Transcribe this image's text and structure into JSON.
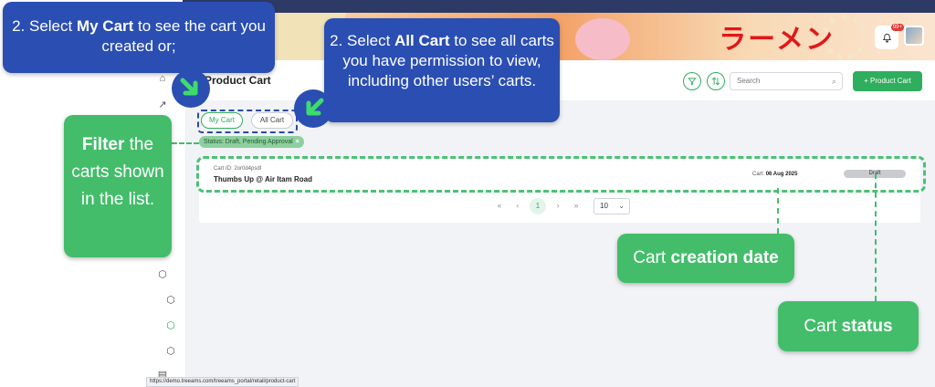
{
  "header": {
    "page_title": "Product Cart",
    "search_placeholder": "Search",
    "add_button_label": "+ Product Cart",
    "notification_badge": "99+",
    "banner_text": "ラーメン"
  },
  "tabs": {
    "my_cart": "My Cart",
    "all_cart": "All Cart"
  },
  "filter_chip": {
    "label": "Status: Draft, Pending Approval",
    "remove": "×"
  },
  "cart_row": {
    "id_label": "Cart ID: 2or0d4psdl",
    "name": "Thumbs Up @ Air Itam Road",
    "date_prefix": "Cart:",
    "date": "06 Aug 2025",
    "status": "Draft"
  },
  "pagination": {
    "first": "«",
    "prev": "‹",
    "current_page": "1",
    "next": "›",
    "last": "»",
    "page_size": "10"
  },
  "status_url": "https://demo.treeams.com/treeams_portal/retail/product-cart",
  "callouts": {
    "my_cart_pre": "2. Select ",
    "my_cart_bold": "My Cart",
    "my_cart_post": " to see the cart you created or;",
    "all_cart_pre": "2. Select ",
    "all_cart_bold": "All Cart",
    "all_cart_post": " to see all carts you have permission to view, including other users’ carts.",
    "filter_bold": "Filter",
    "filter_rest": " the carts shown in the list.",
    "creation_pre": "Cart ",
    "creation_bold": "creation date",
    "status_pre": "Cart ",
    "status_bold": "status"
  },
  "icons": {
    "sidebar": [
      "home-icon",
      "chart-icon",
      "box-icon",
      "box-icon",
      "box-icon",
      "box-icon",
      "box-icon",
      "box-icon",
      "cube-icon",
      "cube-icon",
      "cube-icon",
      "cube-icon",
      "doc-icon"
    ],
    "filter": "filter-icon",
    "sort": "sort-icon",
    "search": "search-icon",
    "bell": "bell-icon"
  },
  "colors": {
    "accent_green": "#2fae5d",
    "callout_blue": "#2a4eb2",
    "callout_green": "#43bd6a"
  }
}
